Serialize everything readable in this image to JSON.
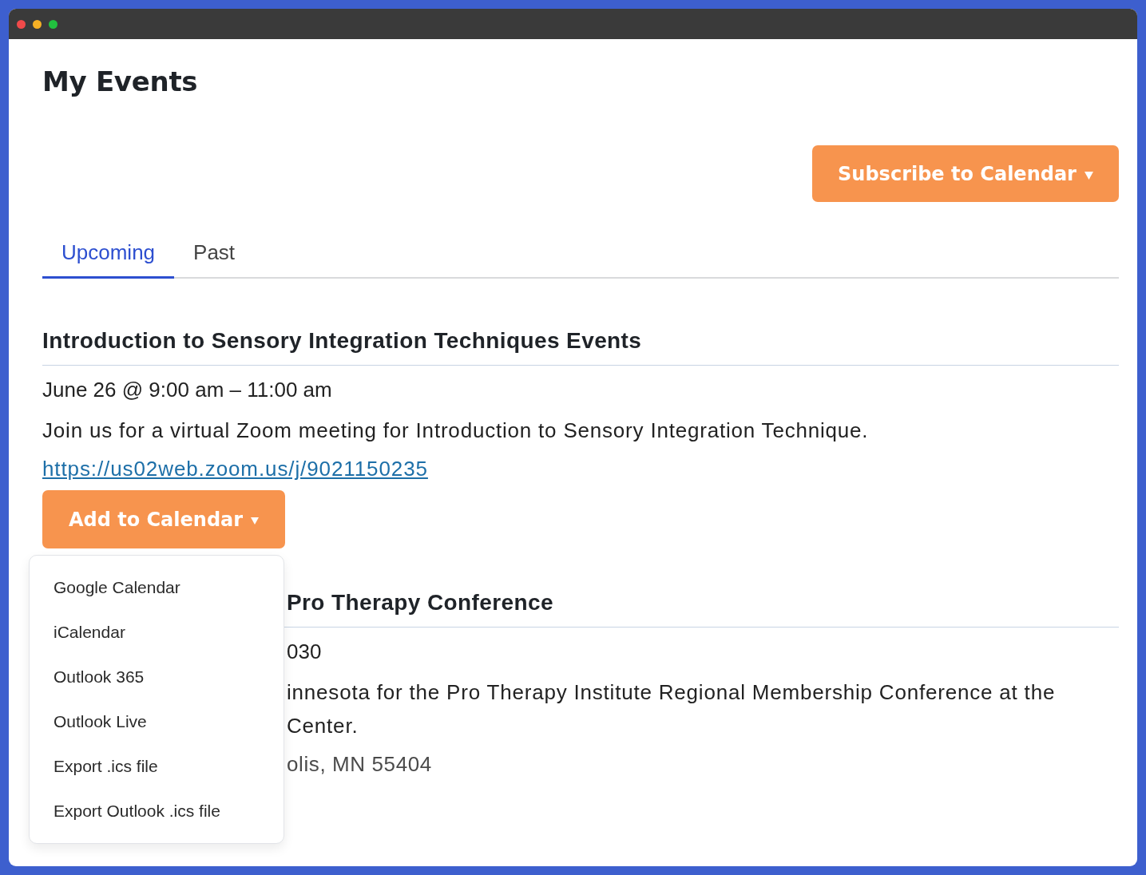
{
  "page": {
    "title": "My Events"
  },
  "subscribe_button": {
    "label": "Subscribe to Calendar"
  },
  "tabs": [
    {
      "label": "Upcoming",
      "selected": true
    },
    {
      "label": "Past",
      "selected": false
    }
  ],
  "events": [
    {
      "title": "Introduction to Sensory Integration Techniques Events",
      "date": "June 26 @ 9:00 am – 11:00 am",
      "description": [
        "Join us for a virtual Zoom meeting for Introduction to Sensory Integration Technique."
      ],
      "link": "https://us02web.zoom.us/j/9021150235",
      "calendar_button": {
        "label": "Add to Calendar",
        "menu_open": true,
        "menu_items": [
          "Google Calendar",
          "iCalendar",
          "Outlook 365",
          "Outlook Live",
          "Export .ics file",
          "Export Outlook .ics file"
        ]
      }
    },
    {
      "title": "Pro Therapy Conference",
      "date": "030",
      "description": [
        "innesota for the Pro Therapy Institute Regional Membership Conference at the",
        "Center."
      ],
      "address": "olis, MN 55404"
    }
  ]
}
